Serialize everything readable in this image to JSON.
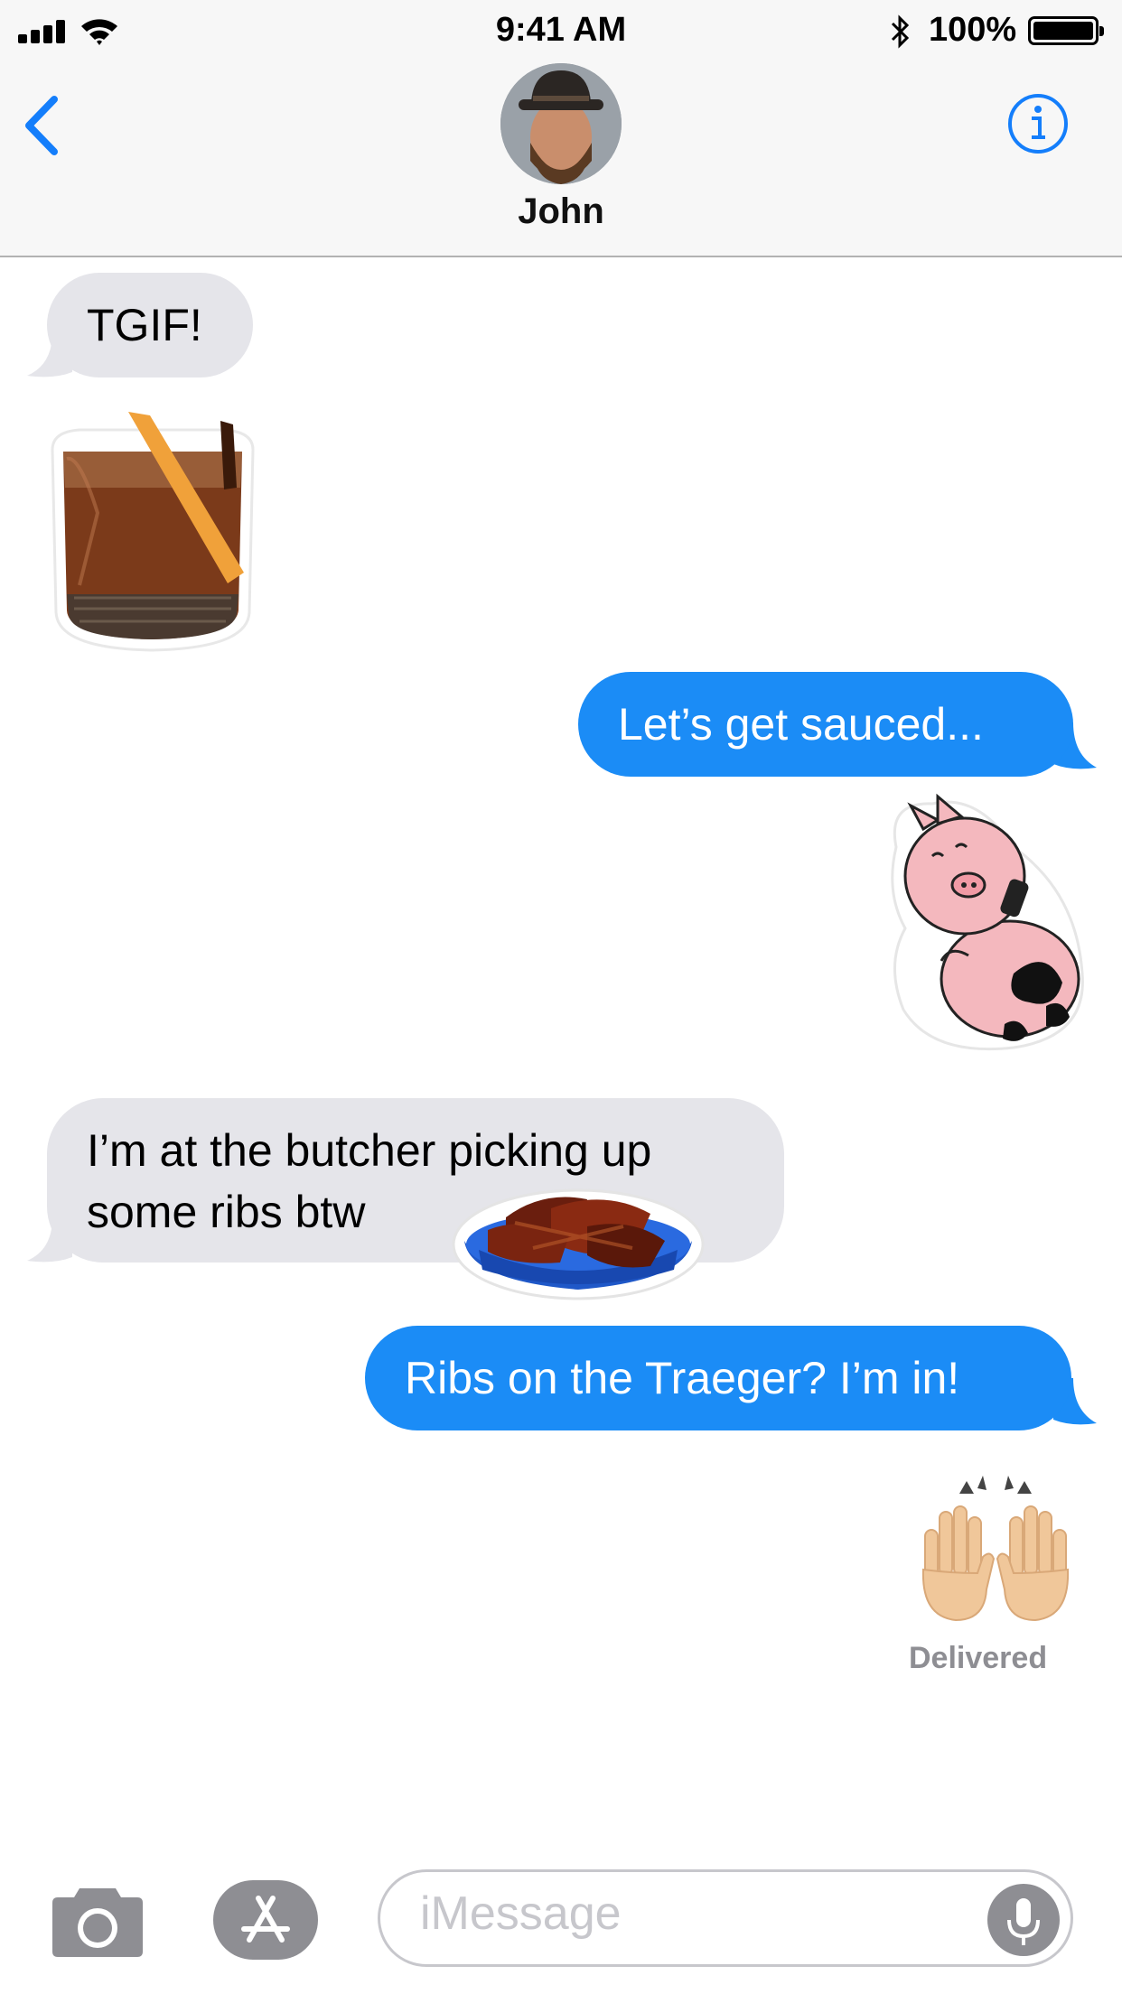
{
  "status_bar": {
    "time": "9:41 AM",
    "battery_percent": "100%"
  },
  "header": {
    "contact_name": "John"
  },
  "messages": [
    {
      "direction": "incoming",
      "text": "TGIF!"
    },
    {
      "direction": "incoming",
      "sticker": "old-fashioned-cocktail"
    },
    {
      "direction": "outgoing",
      "text": "Let’s get sauced..."
    },
    {
      "direction": "outgoing",
      "sticker": "pig-with-sauce-bottle"
    },
    {
      "direction": "incoming",
      "text_line1": "I’m at the butcher picking up",
      "text_line2": "some ribs btw",
      "sticker": "ribs-basket"
    },
    {
      "direction": "outgoing",
      "text": "Ribs on the Traeger? I’m in!"
    },
    {
      "direction": "outgoing",
      "sticker": "raised-hands-emoji"
    }
  ],
  "delivery_status": "Delivered",
  "input_bar": {
    "placeholder": "iMessage"
  },
  "colors": {
    "outgoing": "#1b8cf6",
    "incoming": "#e5e5ea",
    "tint": "#147efb"
  }
}
